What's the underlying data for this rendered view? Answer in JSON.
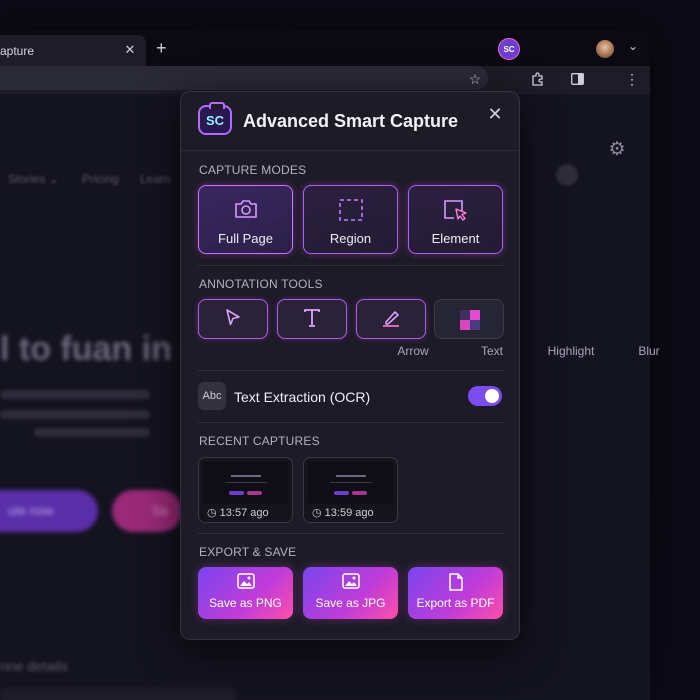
{
  "browser": {
    "tab_title": "apture",
    "tab_close": "✕",
    "new_tab": "+",
    "tab_dropdown": "⌄"
  },
  "page": {
    "nav_items": [
      "Stories ⌄",
      "Pricing",
      "Learn"
    ],
    "hero_text": "l to fuan in s",
    "cta_primary": "ute now",
    "cta_secondary": "Sa",
    "details_heading": "nne details"
  },
  "popup": {
    "logo_text": "SC",
    "title": "Advanced Smart Capture",
    "close_glyph": "✕",
    "capture_modes": {
      "heading": "CAPTURE MODES",
      "items": [
        {
          "label": "Full Page",
          "icon": "camera-icon"
        },
        {
          "label": "Region",
          "icon": "region-select-icon"
        },
        {
          "label": "Element",
          "icon": "element-select-icon"
        }
      ]
    },
    "annotation_tools": {
      "heading": "ANNOTATION TOOLS",
      "items": [
        {
          "label": "Arrow",
          "icon": "arrow-cursor-icon"
        },
        {
          "label": "Text",
          "icon": "text-tool-icon"
        },
        {
          "label": "Highlight",
          "icon": "highlighter-icon"
        },
        {
          "label": "Blur",
          "icon": "blur-icon"
        }
      ]
    },
    "ocr": {
      "badge": "Abc",
      "label": "Text Extraction (OCR)",
      "enabled": true
    },
    "recent_captures": {
      "heading": "RECENT CAPTURES",
      "items": [
        {
          "time": "13:57 ago"
        },
        {
          "time": "13:59 ago"
        }
      ]
    },
    "export": {
      "heading": "EXPORT & SAVE",
      "items": [
        {
          "label": "Save as PNG",
          "icon": "image-icon"
        },
        {
          "label": "Save as JPG",
          "icon": "image-icon"
        },
        {
          "label": "Export as PDF",
          "icon": "document-icon"
        }
      ]
    }
  },
  "colors": {
    "accent_purple": "#7b4df0",
    "accent_pink": "#ff4fa8",
    "popup_bg": "#1c1b26"
  }
}
